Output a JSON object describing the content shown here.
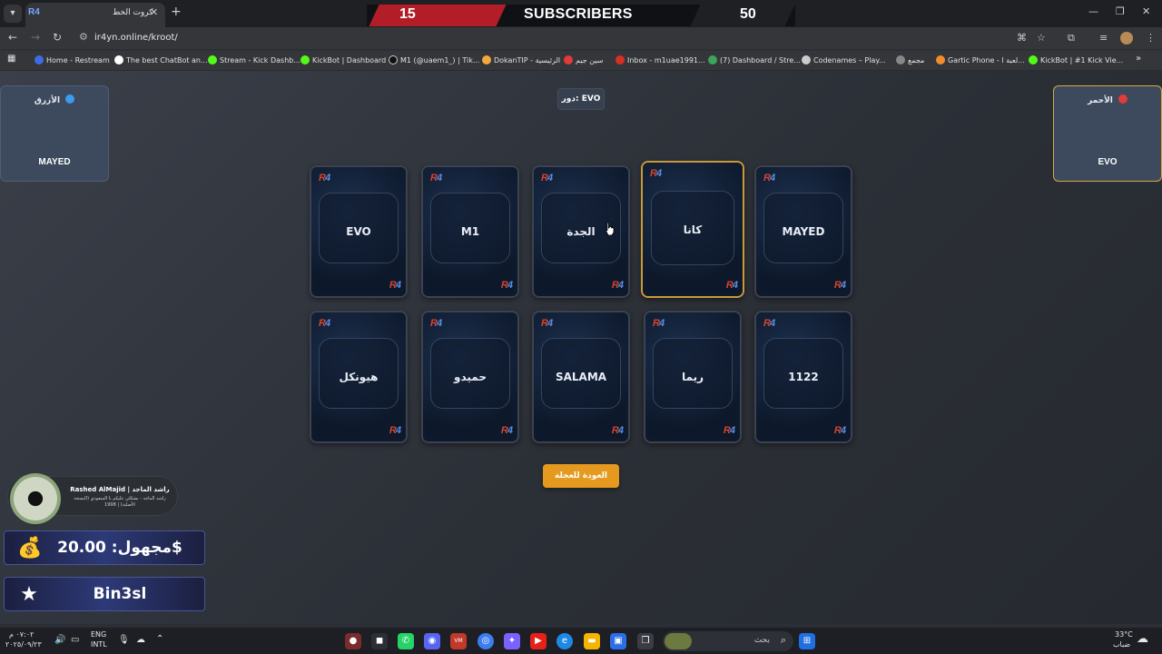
{
  "browser": {
    "tab_title": "كروت الخط",
    "tab_close": "✕",
    "new_tab": "+",
    "url": "ir4yn.online/kroot/",
    "bookmarks": [
      {
        "label": "Home - Restream",
        "color": "#3f6be8"
      },
      {
        "label": "The best ChatBot an...",
        "color": "#ffffff"
      },
      {
        "label": "Stream - Kick Dashb...",
        "color": "#53fc18"
      },
      {
        "label": "KickBot | Dashboard",
        "color": "#53fc18"
      },
      {
        "label": "M1 (@uaem1_) | Tik...",
        "color": "#111111"
      },
      {
        "label": "DokanTIP - الرئيسية",
        "color": "#f2a93b"
      },
      {
        "label": "سين جيم",
        "color": "#e03b3b"
      },
      {
        "label": "Inbox - m1uae1991...",
        "color": "#d93025"
      },
      {
        "label": "(7) Dashboard / Stre...",
        "color": "#3aa55c"
      },
      {
        "label": "Codenames – Play...",
        "color": "#cccccc"
      },
      {
        "label": "مجمع",
        "color": "#888888"
      },
      {
        "label": "Gartic Phone - لعبة ا...",
        "color": "#f28c2b"
      },
      {
        "label": "KickBot | #1 Kick Vie...",
        "color": "#53fc18"
      }
    ]
  },
  "stream_bar": {
    "left_count": "15",
    "label": "SUBSCRIBERS",
    "right_count": "50"
  },
  "game": {
    "blue_team": {
      "name": "الأزرق",
      "color": "#3b9cf0",
      "members": [
        "MAYED"
      ]
    },
    "red_team": {
      "name": "الأحمر",
      "color": "#e23b3b",
      "members": [
        "EVO"
      ]
    },
    "turn_label": "دور: EVO",
    "cards": [
      {
        "word": "EVO",
        "selected": false
      },
      {
        "word": "M1",
        "selected": false
      },
      {
        "word": "الجدة",
        "selected": false
      },
      {
        "word": "كانا",
        "selected": true
      },
      {
        "word": "MAYED",
        "selected": false
      },
      {
        "word": "هيونكل",
        "selected": false
      },
      {
        "word": "حميدو",
        "selected": false
      },
      {
        "word": "SALAMA",
        "selected": false
      },
      {
        "word": "ريما",
        "selected": false
      },
      {
        "word": "1122",
        "selected": false
      }
    ],
    "card_logo": "R4",
    "back_button": "العودة للعجلة"
  },
  "overlays": {
    "profile": {
      "name": "Rashed AlMajid | راشد الماجد",
      "bio": "راشد الماجد - بشكلي عليكم يا السعودي (النسخة الأصلية) | 1998"
    },
    "donation": {
      "icon": "money-bag-icon",
      "text": "مجهول: 20.00$"
    },
    "follower": {
      "icon": "star-icon",
      "text": "Bin3sl"
    }
  },
  "taskbar": {
    "time": "٠٧:٠٢ م",
    "date": "٢٠٢٥/٠٩/٢٣",
    "lang_top": "ENG",
    "lang_bottom": "INTL",
    "search_label": "بحث",
    "weather_temp": "33°C",
    "weather_desc": "ضباب"
  }
}
